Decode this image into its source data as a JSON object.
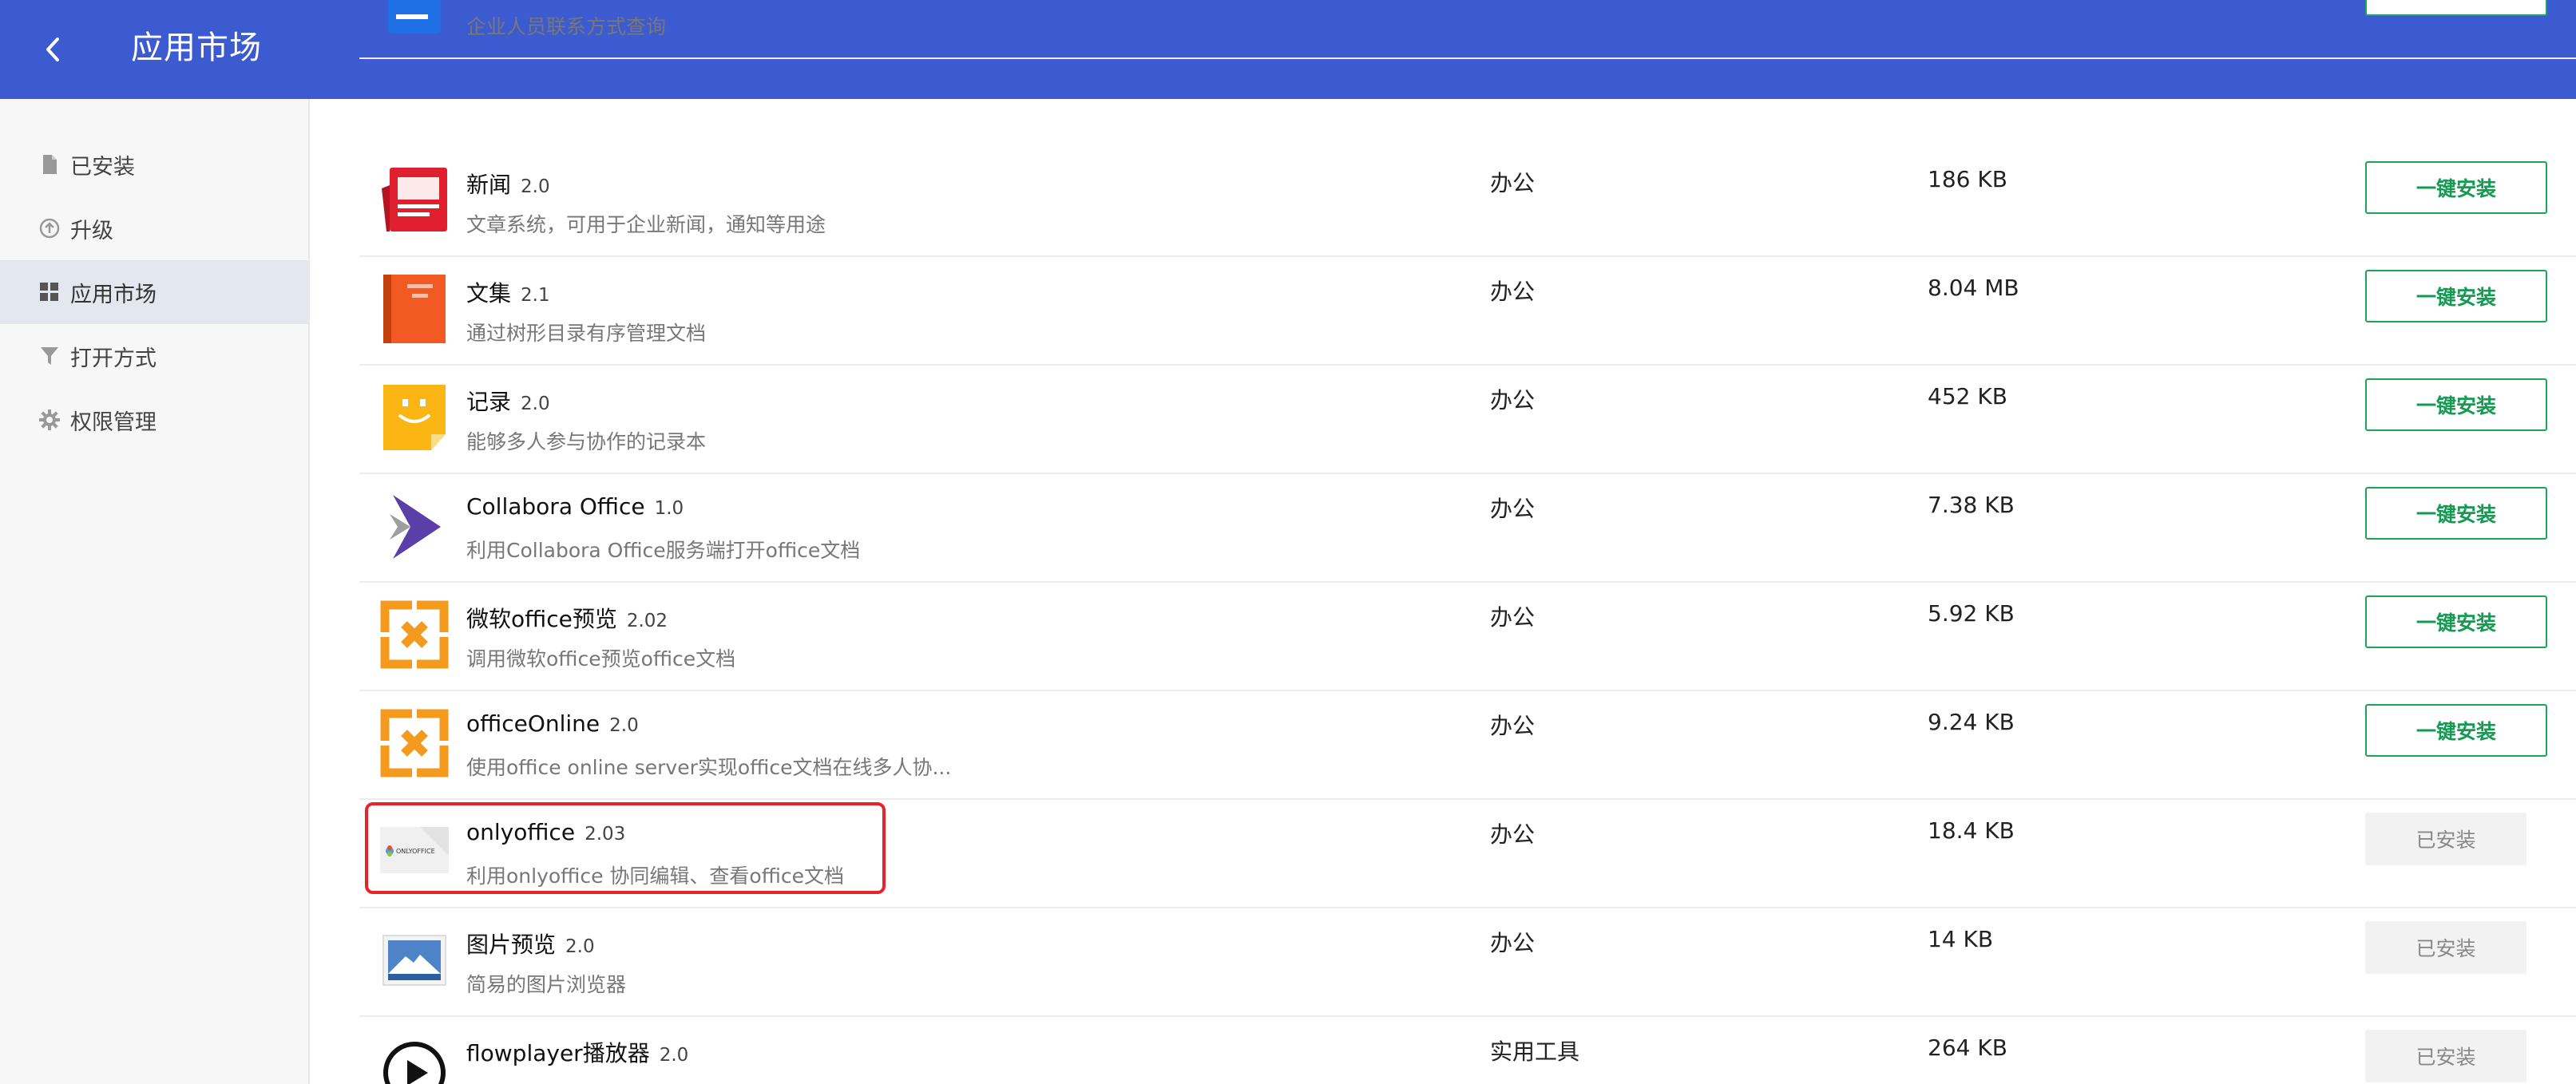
{
  "header": {
    "title": "应用市场"
  },
  "sidebar": {
    "items": [
      {
        "label": "已安装",
        "icon": "file-icon"
      },
      {
        "label": "升级",
        "icon": "upgrade-circle-icon"
      },
      {
        "label": "应用市场",
        "icon": "grid-icon",
        "active": true
      },
      {
        "label": "打开方式",
        "icon": "filter-icon"
      },
      {
        "label": "权限管理",
        "icon": "gear-icon"
      }
    ]
  },
  "apps": [
    {
      "name": "",
      "version": "",
      "desc": "企业人员联系方式查询",
      "category": "",
      "size": "",
      "status": "install",
      "icon": "contacts-app-icon"
    },
    {
      "name": "新闻",
      "version": "2.0",
      "desc": "文章系统，可用于企业新闻，通知等用途",
      "category": "办公",
      "size": "186 KB",
      "status": "install",
      "icon": "news-app-icon"
    },
    {
      "name": "文集",
      "version": "2.1",
      "desc": "通过树形目录有序管理文档",
      "category": "办公",
      "size": "8.04 MB",
      "status": "install",
      "icon": "book-app-icon"
    },
    {
      "name": "记录",
      "version": "2.0",
      "desc": "能够多人参与协作的记录本",
      "category": "办公",
      "size": "452 KB",
      "status": "install",
      "icon": "note-app-icon"
    },
    {
      "name": "Collabora Office",
      "version": "1.0",
      "desc": "利用Collabora Office服务端打开office文档",
      "category": "办公",
      "size": "7.38 KB",
      "status": "install",
      "icon": "collabora-app-icon"
    },
    {
      "name": "微软office预览",
      "version": "2.02",
      "desc": "调用微软office预览office文档",
      "category": "办公",
      "size": "5.92 KB",
      "status": "install",
      "icon": "ms-office-app-icon"
    },
    {
      "name": "officeOnline",
      "version": "2.0",
      "desc": "使用office online server实现office文档在线多人协...",
      "category": "办公",
      "size": "9.24 KB",
      "status": "install",
      "icon": "office-online-app-icon"
    },
    {
      "name": "onlyoffice",
      "version": "2.03",
      "desc": "利用onlyoffice 协同编辑、查看office文档",
      "category": "办公",
      "size": "18.4 KB",
      "status": "installed",
      "icon": "onlyoffice-app-icon",
      "icon_text": "ONLYOFFICE"
    },
    {
      "name": "图片预览",
      "version": "2.0",
      "desc": "简易的图片浏览器",
      "category": "办公",
      "size": "14 KB",
      "status": "installed",
      "icon": "image-preview-app-icon"
    },
    {
      "name": "flowplayer播放器",
      "version": "2.0",
      "desc": "",
      "category": "实用工具",
      "size": "264 KB",
      "status": "installed",
      "icon": "play-app-icon"
    }
  ],
  "labels": {
    "install": "一键安装",
    "installed": "已安装"
  },
  "colors": {
    "header_bg": "#3d5bd0",
    "install_green": "#1aa75b",
    "highlight_red": "#e8232a"
  }
}
